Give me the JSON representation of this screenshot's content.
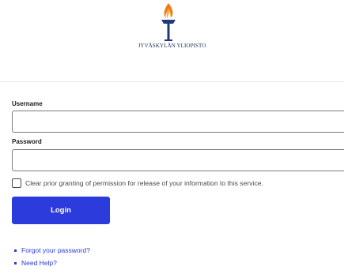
{
  "header": {
    "university_name": "JYVÄSKYLÄN YLIOPISTO"
  },
  "form": {
    "username_label": "Username",
    "username_value": "",
    "password_label": "Password",
    "password_value": "",
    "clear_permission_label": "Clear prior granting of permission for release of your information to this service.",
    "clear_permission_checked": false,
    "login_label": "Login"
  },
  "links": {
    "forgot_password": "Forgot your password?",
    "need_help": "Need Help?"
  },
  "colors": {
    "accent": "#2b3bdc",
    "logo_flame_orange": "#f07a1a",
    "logo_blue": "#1e3a7a"
  },
  "icons": {
    "logo": "torch-logo-icon",
    "bullet": "bullet-icon"
  }
}
